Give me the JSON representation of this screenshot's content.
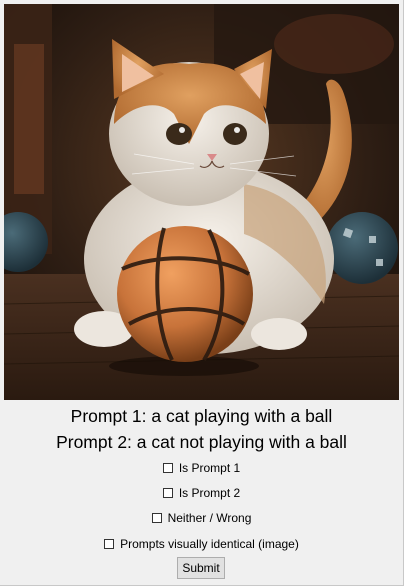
{
  "image": {
    "subject": "kitten-with-basketball"
  },
  "prompts": {
    "prompt1": "Prompt 1: a cat playing with a ball",
    "prompt2": "Prompt 2: a cat not playing with a ball"
  },
  "options": {
    "opt1": "Is Prompt 1",
    "opt2": "Is Prompt 2",
    "opt3": "Neither / Wrong",
    "opt4": "Prompts visually identical (image)"
  },
  "submit_label": "Submit"
}
